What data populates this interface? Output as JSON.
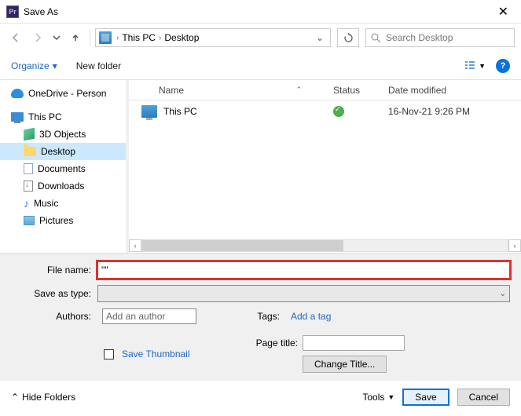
{
  "window": {
    "title": "Save As"
  },
  "nav": {
    "breadcrumb": [
      "This PC",
      "Desktop"
    ],
    "search_placeholder": "Search Desktop"
  },
  "toolbar": {
    "organize": "Organize",
    "new_folder": "New folder",
    "help": "?"
  },
  "tree": {
    "items": [
      {
        "label": "OneDrive - Person",
        "icon": "cloud",
        "level": 0
      },
      {
        "label": "This PC",
        "icon": "pc",
        "level": 0
      },
      {
        "label": "3D Objects",
        "icon": "cube",
        "level": 1
      },
      {
        "label": "Desktop",
        "icon": "folder",
        "level": 1,
        "selected": true
      },
      {
        "label": "Documents",
        "icon": "doc",
        "level": 1
      },
      {
        "label": "Downloads",
        "icon": "down",
        "level": 1
      },
      {
        "label": "Music",
        "icon": "music",
        "level": 1
      },
      {
        "label": "Pictures",
        "icon": "pic",
        "level": 1
      }
    ]
  },
  "listing": {
    "columns": {
      "name": "Name",
      "status": "Status",
      "date": "Date modified"
    },
    "rows": [
      {
        "name": "This PC",
        "status": "ok",
        "date": "16-Nov-21 9:26 PM"
      }
    ]
  },
  "form": {
    "file_name_label": "File name:",
    "file_name_value": "\"\"",
    "save_type_label": "Save as type:",
    "authors_label": "Authors:",
    "authors_placeholder": "Add an author",
    "tags_label": "Tags:",
    "tags_link": "Add a tag",
    "save_thumb": "Save Thumbnail",
    "page_title_label": "Page title:",
    "change_title": "Change Title..."
  },
  "footer": {
    "hide": "Hide Folders",
    "tools": "Tools",
    "save": "Save",
    "cancel": "Cancel"
  }
}
